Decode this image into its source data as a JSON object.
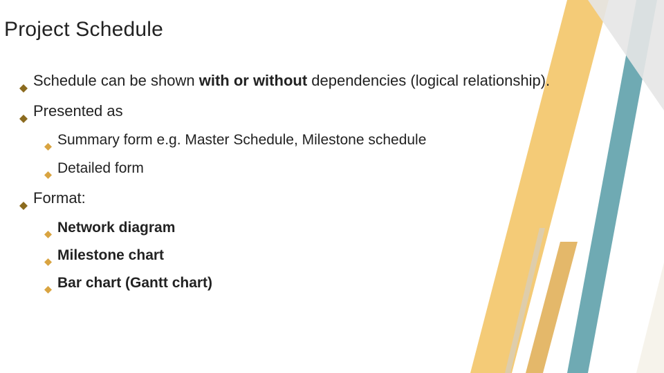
{
  "title": "Project Schedule",
  "bullets": {
    "l1_1_pre": "Schedule can be shown ",
    "l1_1_bold": "with or without",
    "l1_1_post": " dependencies (logical relationship).",
    "l1_2": "Presented as",
    "l2_1": "Summary form e.g. Master Schedule, Milestone schedule",
    "l2_2": "Detailed form",
    "l1_3": "Format:",
    "l2_3": "Network diagram",
    "l2_4": "Milestone chart",
    "l2_5": "Bar chart (Gantt chart)"
  }
}
